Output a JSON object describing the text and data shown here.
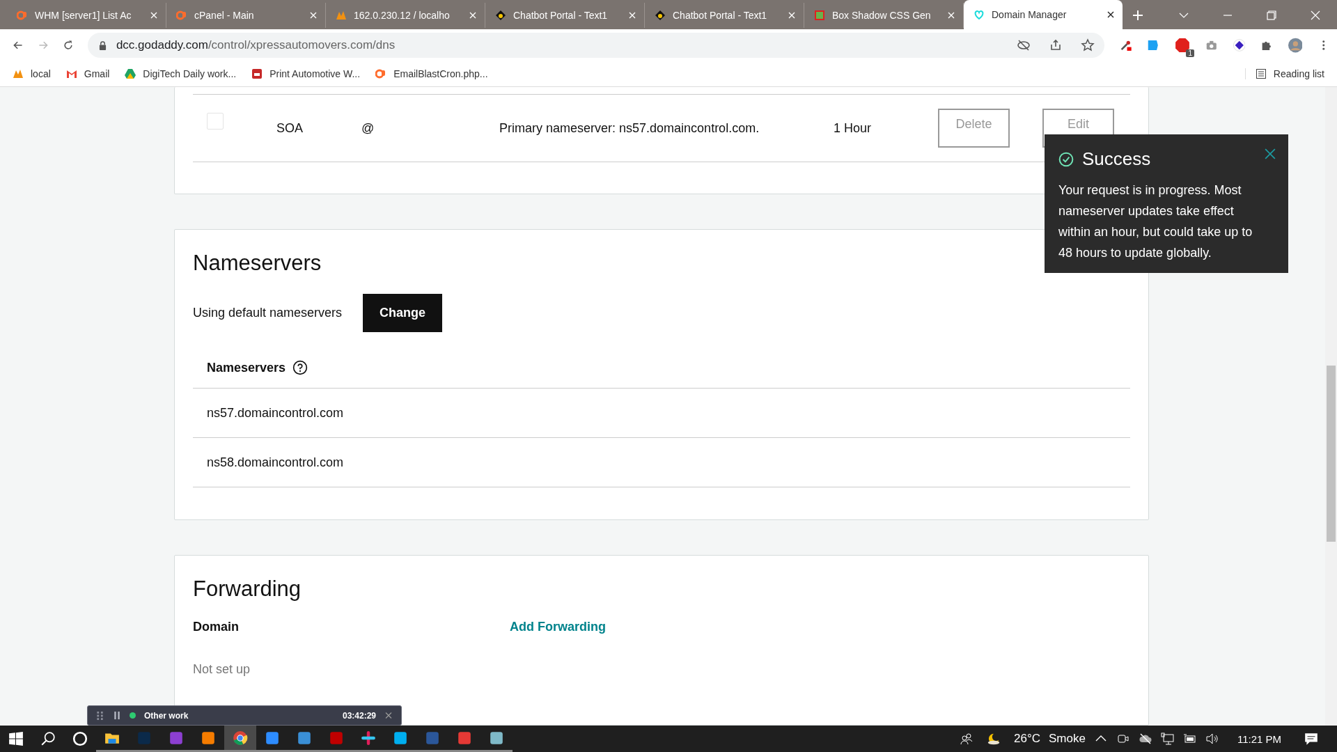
{
  "browser": {
    "tabs": [
      {
        "title": "WHM [server1] List Ac",
        "kind": "cpanel",
        "selected": false
      },
      {
        "title": "cPanel - Main",
        "kind": "cpanel",
        "selected": false
      },
      {
        "title": "162.0.230.12 / localho",
        "kind": "pma",
        "selected": false
      },
      {
        "title": "Chatbot Portal - Text1",
        "kind": "chatbot",
        "selected": false
      },
      {
        "title": "Chatbot Portal - Text1",
        "kind": "chatbot",
        "selected": false
      },
      {
        "title": "Box Shadow CSS Gen",
        "kind": "box",
        "selected": false
      },
      {
        "title": "Domain Manager",
        "kind": "godaddy",
        "selected": true
      }
    ],
    "address": {
      "host": "dcc.godaddy.com",
      "path": "/control/xpressautomovers.com/dns"
    },
    "bookmarks": [
      {
        "label": "local",
        "kind": "pma"
      },
      {
        "label": "Gmail",
        "kind": "gmail"
      },
      {
        "label": "DigiTech Daily work...",
        "kind": "drive"
      },
      {
        "label": "Print Automotive W...",
        "kind": "print"
      },
      {
        "label": "EmailBlastCron.php...",
        "kind": "cpanel"
      }
    ],
    "reading_list": "Reading list",
    "extension_badge": "1"
  },
  "dns_record": {
    "checked": false,
    "type": "SOA",
    "name": "@",
    "value": "Primary nameserver: ns57.domaincontrol.com.",
    "ttl": "1 Hour",
    "buttons": [
      "Delete",
      "Edit"
    ]
  },
  "nameservers": {
    "title": "Nameservers",
    "status": "Using default nameservers",
    "change_button": "Change",
    "column": "Nameservers",
    "items": [
      "ns57.domaincontrol.com",
      "ns58.domaincontrol.com"
    ]
  },
  "forwarding": {
    "title": "Forwarding",
    "column_1": "Domain",
    "add_link": "Add Forwarding",
    "status": "Not set up"
  },
  "toast": {
    "title": "Success",
    "message": "Your request is in progress. Most nameserver updates take effect within an hour, but could take up to 48 hours to update globally."
  },
  "timer": {
    "label": "Other work",
    "time": "03:42:29"
  },
  "taskbar": {
    "apps": [
      {
        "kind": "explorer",
        "active": false
      },
      {
        "kind": "photoshop",
        "active": false
      },
      {
        "kind": "phpstorm",
        "active": false
      },
      {
        "kind": "sublime",
        "active": false
      },
      {
        "kind": "chrome",
        "active": true
      },
      {
        "kind": "zoom",
        "active": false
      },
      {
        "kind": "pcp",
        "active": false
      },
      {
        "kind": "filezilla",
        "active": false
      },
      {
        "kind": "slack",
        "active": false
      },
      {
        "kind": "skype",
        "active": false
      },
      {
        "kind": "word",
        "active": false
      },
      {
        "kind": "check",
        "active": false
      },
      {
        "kind": "notepad",
        "active": false
      }
    ],
    "temperature": "26°C",
    "weather": "Smoke",
    "clock": "11:21 PM"
  }
}
